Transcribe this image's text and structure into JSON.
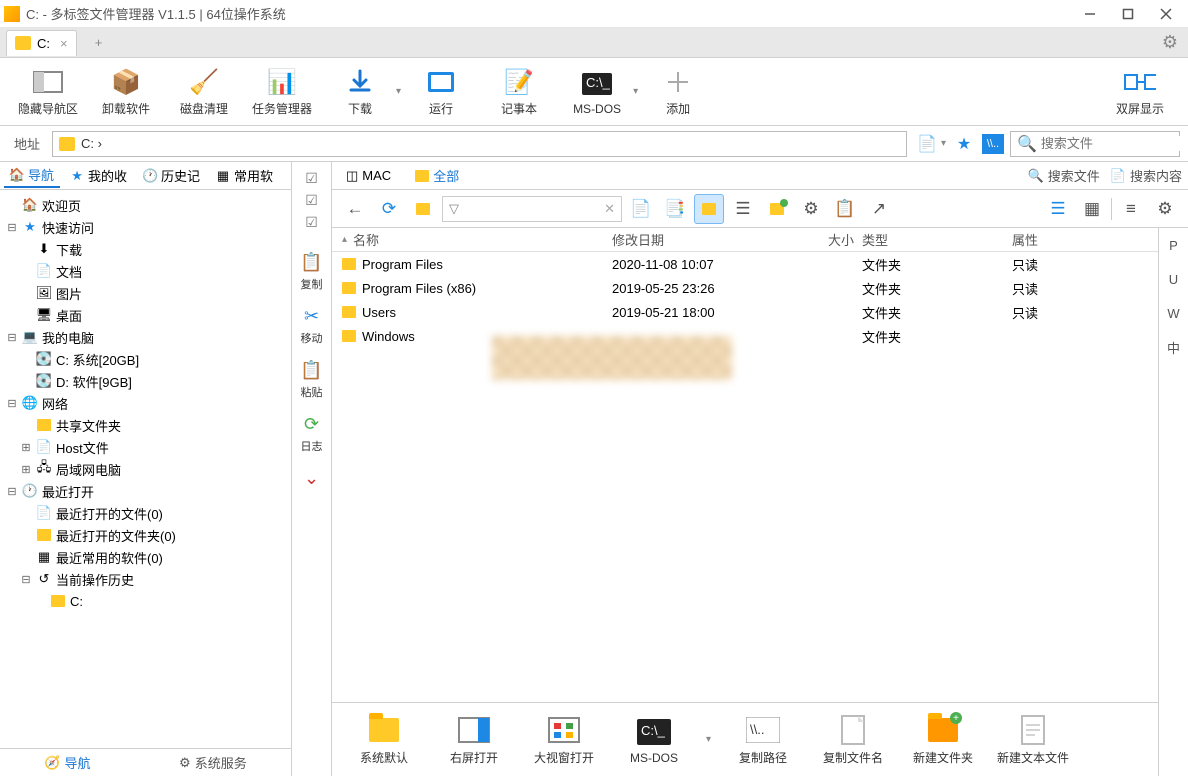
{
  "window": {
    "title": "C: - 多标签文件管理器 V1.1.5  |  64位操作系统"
  },
  "path_tab": {
    "label": "C:"
  },
  "toolbar": {
    "hide_nav": "隐藏导航区",
    "uninstall": "卸载软件",
    "disk_clean": "磁盘清理",
    "task_mgr": "任务管理器",
    "download": "下载",
    "run": "运行",
    "notepad": "记事本",
    "msdos": "MS-DOS",
    "add": "添加",
    "dual": "双屏显示"
  },
  "address": {
    "label": "地址",
    "path": "C:  ›"
  },
  "search": {
    "placeholder": "搜索文件"
  },
  "left_tabs": {
    "nav": "导航",
    "fav": "我的收",
    "history": "历史记",
    "common": "常用软"
  },
  "tree": {
    "welcome": "欢迎页",
    "quick": "快速访问",
    "downloads": "下载",
    "documents": "文档",
    "pictures": "图片",
    "desktop": "桌面",
    "mypc": "我的电脑",
    "drive_c": "C: 系统[20GB]",
    "drive_d": "D: 软件[9GB]",
    "network": "网络",
    "shared": "共享文件夹",
    "hosts": "Host文件",
    "lan": "局域网电脑",
    "recent": "最近打开",
    "recent_files": "最近打开的文件(0)",
    "recent_folders": "最近打开的文件夹(0)",
    "recent_soft": "最近常用的软件(0)",
    "current_hist": "当前操作历史",
    "hist_c": "C:"
  },
  "left_bottom": {
    "nav": "导航",
    "services": "系统服务"
  },
  "side_actions": {
    "copy": "复制",
    "move": "移动",
    "paste": "粘贴",
    "log": "日志"
  },
  "filter_tabs": {
    "mac": "MAC",
    "all": "全部",
    "search_files": "搜索文件",
    "search_content": "搜索内容"
  },
  "columns": {
    "name": "名称",
    "date": "修改日期",
    "size": "大小",
    "type": "类型",
    "attr": "属性"
  },
  "files": [
    {
      "name": "Program Files",
      "date": "2020-11-08 10:07",
      "size": "",
      "type": "文件夹",
      "attr": "只读"
    },
    {
      "name": "Program Files (x86)",
      "date": "2019-05-25 23:26",
      "size": "",
      "type": "文件夹",
      "attr": "只读"
    },
    {
      "name": "Users",
      "date": "2019-05-21 18:00",
      "size": "",
      "type": "文件夹",
      "attr": "只读"
    },
    {
      "name": "Windows",
      "date": "",
      "size": "",
      "type": "文件夹",
      "attr": ""
    }
  ],
  "letters": [
    "P",
    "U",
    "W",
    "中"
  ],
  "bottom": {
    "system_default": "系统默认",
    "open_right": "右屏打开",
    "open_big": "大视窗打开",
    "msdos": "MS-DOS",
    "copy_path": "复制路径",
    "copy_name": "复制文件名",
    "new_folder": "新建文件夹",
    "new_text": "新建文本文件"
  }
}
